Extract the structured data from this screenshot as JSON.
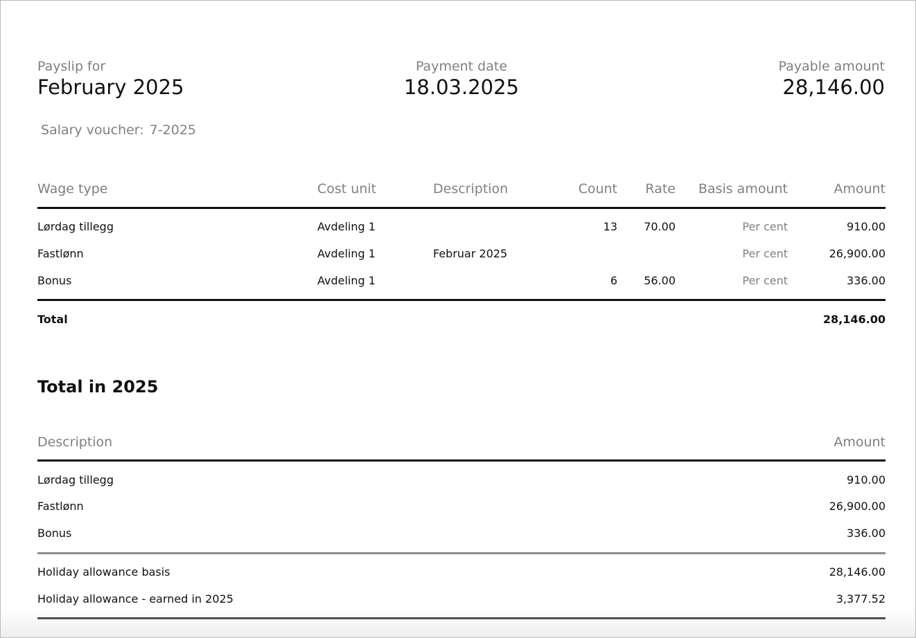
{
  "header": {
    "payslip_label": "Payslip for",
    "payslip_period": "February 2025",
    "payment_date_label": "Payment date",
    "payment_date": "18.03.2025",
    "payable_label": "Payable amount",
    "payable_amount": "28,146.00"
  },
  "voucher": {
    "label": "Salary voucher:",
    "value": "7-2025"
  },
  "wage_table": {
    "columns": {
      "wage_type": "Wage type",
      "cost_unit": "Cost unit",
      "description": "Description",
      "count": "Count",
      "rate": "Rate",
      "basis": "Basis amount",
      "amount": "Amount"
    },
    "rows": [
      {
        "wage_type": "Lørdag tillegg",
        "cost_unit": "Avdeling 1",
        "description": "",
        "count": "13",
        "rate": "70.00",
        "basis": "Per cent",
        "amount": "910.00"
      },
      {
        "wage_type": "Fastlønn",
        "cost_unit": "Avdeling 1",
        "description": "Februar 2025",
        "count": "",
        "rate": "",
        "basis": "Per cent",
        "amount": "26,900.00"
      },
      {
        "wage_type": "Bonus",
        "cost_unit": "Avdeling 1",
        "description": "",
        "count": "6",
        "rate": "56.00",
        "basis": "Per cent",
        "amount": "336.00"
      }
    ],
    "total_label": "Total",
    "total_amount": "28,146.00"
  },
  "year_section": {
    "title": "Total in 2025",
    "columns": {
      "description": "Description",
      "amount": "Amount"
    },
    "rows": [
      {
        "description": "Lørdag tillegg",
        "amount": "910.00"
      },
      {
        "description": "Fastlønn",
        "amount": "26,900.00"
      },
      {
        "description": "Bonus",
        "amount": "336.00"
      }
    ],
    "holiday_rows": [
      {
        "description": "Holiday allowance basis",
        "amount": "28,146.00"
      },
      {
        "description": "Holiday allowance - earned in 2025",
        "amount": "3,377.52"
      }
    ]
  }
}
